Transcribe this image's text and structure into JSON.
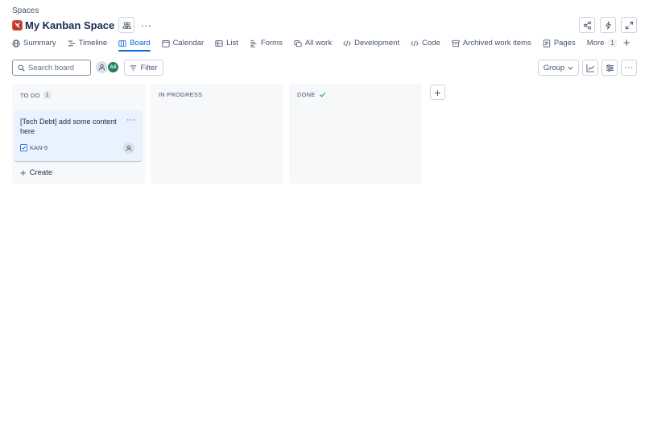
{
  "breadcrumb": "Spaces",
  "space": {
    "title": "My Kanban Space",
    "more": "···"
  },
  "tabs": [
    {
      "label": "Summary",
      "icon": "globe-icon",
      "active": false
    },
    {
      "label": "Timeline",
      "icon": "timeline-icon",
      "active": false
    },
    {
      "label": "Board",
      "icon": "board-icon",
      "active": true
    },
    {
      "label": "Calendar",
      "icon": "calendar-icon",
      "active": false
    },
    {
      "label": "List",
      "icon": "list-icon",
      "active": false
    },
    {
      "label": "Forms",
      "icon": "forms-icon",
      "active": false
    },
    {
      "label": "All work",
      "icon": "all-work-icon",
      "active": false
    },
    {
      "label": "Development",
      "icon": "code-icon",
      "active": false
    },
    {
      "label": "Code",
      "icon": "code-icon",
      "active": false
    },
    {
      "label": "Archived work items",
      "icon": "archive-icon",
      "active": false
    },
    {
      "label": "Pages",
      "icon": "pages-icon",
      "active": false
    }
  ],
  "more_tab": {
    "label": "More",
    "count": "1"
  },
  "add_tab": "+",
  "toolbar": {
    "search_placeholder": "Search board",
    "avatar_initials": "AX",
    "filter_label": "Filter",
    "group_label": "Group",
    "more": "···"
  },
  "columns": [
    {
      "name": "TO DO",
      "count": "1"
    },
    {
      "name": "IN PROGRESS"
    },
    {
      "name": "DONE"
    }
  ],
  "card": {
    "title": "[Tech Debt] add some content here",
    "key": "KAN-9",
    "more": "···"
  },
  "create_label": "Create",
  "add_column": "+",
  "colors": {
    "accent": "#0c66e4",
    "card_bg": "#e9f2ff",
    "column_bg": "#f7f8f9",
    "avatar": "#1f845a",
    "space_icon": "#e34935",
    "done_check": "#22a06b"
  }
}
